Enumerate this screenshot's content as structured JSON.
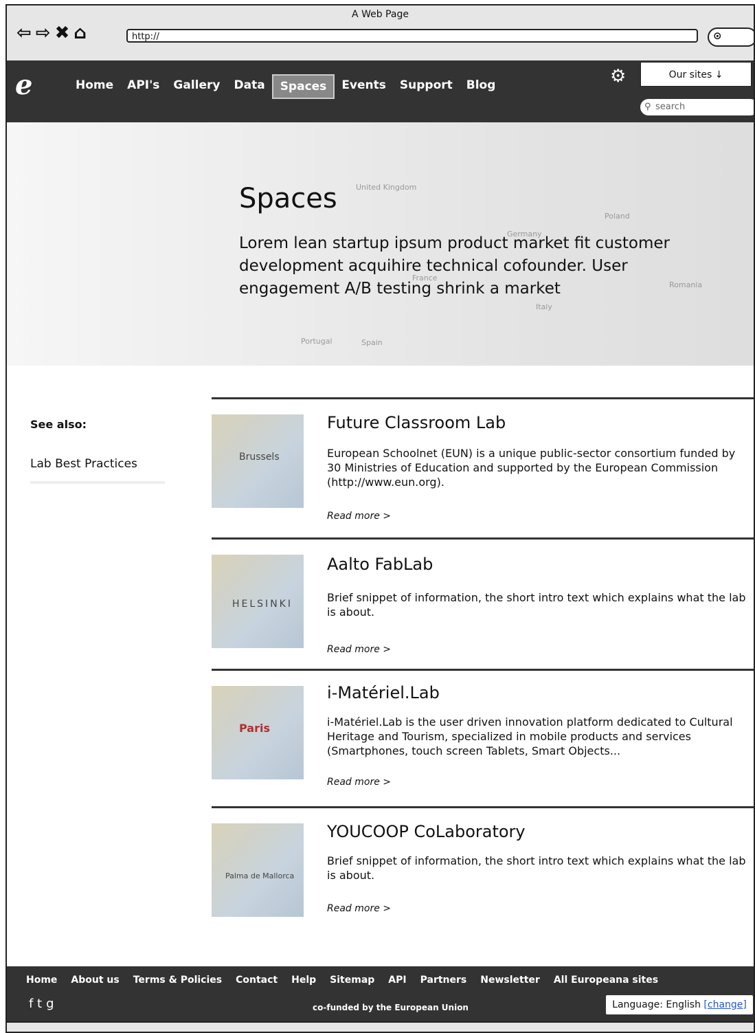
{
  "browser": {
    "title": "A Web Page",
    "url": "http://"
  },
  "nav": {
    "items": [
      "Home",
      "API's",
      "Gallery",
      "Data",
      "Spaces",
      "Events",
      "Support",
      "Blog"
    ],
    "active": "Spaces",
    "our_sites": "Our sites ↓",
    "search_placeholder": "search"
  },
  "hero": {
    "title": "Spaces",
    "text": "Lorem lean startup ipsum product market fit customer development acquihire technical cofounder. User engagement A/B testing shrink a market",
    "map_labels": [
      "United Kingdom",
      "Poland",
      "Germany",
      "France",
      "Italy",
      "Spain",
      "Portugal",
      "Romania"
    ]
  },
  "sidebar": {
    "heading": "See also:",
    "link": "Lab Best Practices"
  },
  "labs": [
    {
      "title": "Future Classroom Lab",
      "description": "European Schoolnet (EUN) is a unique public-sector consortium funded by 30 Ministries of Education and supported by the European Commission (http://www.eun.org).",
      "read_more": "Read more >",
      "map_label": "Brussels"
    },
    {
      "title": "Aalto FabLab",
      "description": "Brief snippet of information, the short intro text which explains what the lab is about.",
      "read_more": "Read more >",
      "map_label": "HELSINKI"
    },
    {
      "title": "i-Matériel.Lab",
      "description": "i-Matériel.Lab is the user driven innovation platform dedicated to Cultural Heritage and Tourism, specialized in mobile products and services (Smartphones, touch screen Tablets, Smart Objects...",
      "read_more": "Read more >",
      "map_label": "Paris"
    },
    {
      "title": "YOUCOOP CoLaboratory",
      "description": "Brief snippet of information, the short intro text which explains what the lab is about.",
      "read_more": "Read more >",
      "map_label": "Palma de Mallorca"
    }
  ],
  "footer": {
    "links": [
      "Home",
      "About us",
      "Terms & Policies",
      "Contact",
      "Help",
      "Sitemap",
      "API",
      "Partners",
      "Newsletter",
      "All Europeana sites"
    ],
    "cofunded": "co-funded by the European Union",
    "language_label": "Language: English",
    "language_change": "[change]"
  }
}
